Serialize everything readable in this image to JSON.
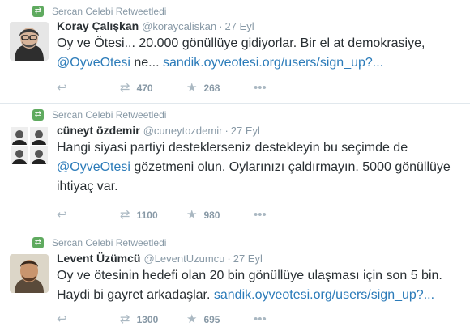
{
  "tweets": [
    {
      "retweet_context": "Sercan Celebi Retweetledi",
      "fullname": "Koray Çalışkan",
      "username": "@koraycaliskan",
      "time": "27 Eyl",
      "text_lines": [
        [
          {
            "t": "Oy ve Ötesi... 20.000 gönüllüye gidiyorlar. Bir el at demokrasiye,",
            "link": false
          }
        ],
        [
          {
            "t": "@OyveOtesi",
            "link": true
          },
          {
            "t": " ne... ",
            "link": false
          },
          {
            "t": "sandik.oyveotesi.org/users/sign_up?...",
            "link": true
          }
        ]
      ],
      "retweet_count": "470",
      "favorite_count": "268"
    },
    {
      "retweet_context": "Sercan Celebi Retweetledi",
      "fullname": "cüneyt özdemir",
      "username": "@cuneytozdemir",
      "time": "27 Eyl",
      "text_lines": [
        [
          {
            "t": "Hangi siyasi partiyi desteklerseniz destekleyin bu seçimde de",
            "link": false
          }
        ],
        [
          {
            "t": "@OyveOtesi",
            "link": true
          },
          {
            "t": " gözetmeni olun. Oylarınızı çaldırmayın. 5000 gönüllüye",
            "link": false
          }
        ],
        [
          {
            "t": "ihtiyaç var.",
            "link": false
          }
        ]
      ],
      "retweet_count": "1100",
      "favorite_count": "980"
    },
    {
      "retweet_context": "Sercan Celebi Retweetledi",
      "fullname": "Levent Üzümcü",
      "username": "@LeventUzumcu",
      "time": "27 Eyl",
      "text_lines": [
        [
          {
            "t": "Oy ve ötesinin hedefi olan 20 bin gönüllüye ulaşması için son 5 bin.",
            "link": false
          }
        ],
        [
          {
            "t": "Haydi bi gayret arkadaşlar. ",
            "link": false
          },
          {
            "t": "sandik.oyveotesi.org/users/sign_up?...",
            "link": true
          }
        ]
      ],
      "retweet_count": "1300",
      "favorite_count": "695"
    }
  ],
  "icons": {
    "retweet_badge": "retweet-icon",
    "reply": "reply-icon",
    "retweet": "retweet-icon",
    "favorite": "star-icon",
    "more": "more-icon"
  },
  "colors": {
    "link": "#2b7bb9",
    "muted": "#8899a6",
    "retweet_badge": "#5faa5f"
  }
}
